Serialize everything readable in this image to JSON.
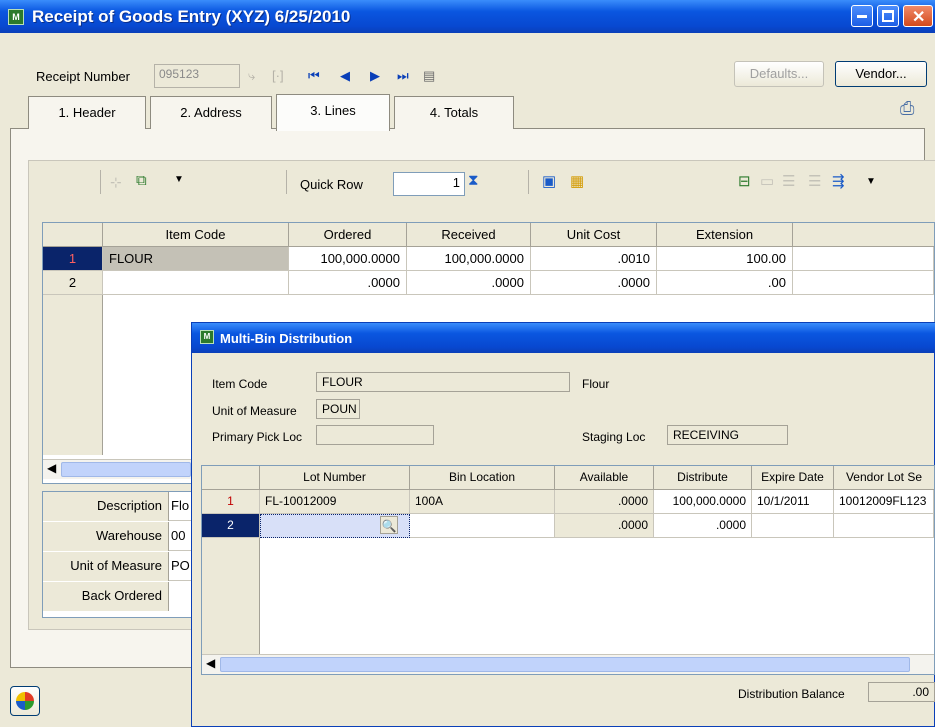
{
  "window": {
    "title": "Receipt of Goods Entry (XYZ) 6/25/2010",
    "app_icon": "mas-icon"
  },
  "header": {
    "receipt_number_label": "Receipt Number",
    "receipt_number_value": "095123",
    "defaults_label": "Defaults...",
    "vendor_label": "Vendor..."
  },
  "tabs": [
    {
      "label": "1. Header"
    },
    {
      "label": "2. Address"
    },
    {
      "label": "3. Lines",
      "active": true
    },
    {
      "label": "4. Totals"
    }
  ],
  "lines_toolbar": {
    "quick_row_label": "Quick Row",
    "quick_row_value": "1"
  },
  "grid": {
    "columns": [
      "Item Code",
      "Ordered",
      "Received",
      "Unit Cost",
      "Extension"
    ],
    "rows": [
      {
        "num": "1",
        "item": "FLOUR",
        "ordered": "100,000.0000",
        "received": "100,000.0000",
        "unit_cost": ".0010",
        "extension": "100.00"
      },
      {
        "num": "2",
        "item": "",
        "ordered": ".0000",
        "received": ".0000",
        "unit_cost": ".0000",
        "extension": ".00"
      }
    ]
  },
  "details": [
    {
      "label": "Description",
      "value": "Flo"
    },
    {
      "label": "Warehouse",
      "value": "00"
    },
    {
      "label": "Unit of Measure",
      "value": "PO"
    },
    {
      "label": "Back Ordered",
      "value": ""
    }
  ],
  "popup": {
    "title": "Multi-Bin Distribution",
    "item_code_label": "Item Code",
    "item_code_value": "FLOUR",
    "item_desc": "Flour",
    "uom_label": "Unit of Measure",
    "uom_value": "POUN",
    "primary_pick_label": "Primary Pick Loc",
    "primary_pick_value": "",
    "staging_label": "Staging Loc",
    "staging_value": "RECEIVING",
    "columns": [
      "Lot Number",
      "Bin Location",
      "Available",
      "Distribute",
      "Expire Date",
      "Vendor Lot Se"
    ],
    "rows": [
      {
        "num": "1",
        "lot": "FL-10012009",
        "bin": "100A",
        "available": ".0000",
        "distribute": "100,000.0000",
        "expire": "10/1/2011",
        "vendor_lot": "10012009FL123"
      },
      {
        "num": "2",
        "lot": "",
        "bin": "",
        "available": ".0000",
        "distribute": ".0000",
        "expire": "",
        "vendor_lot": ""
      }
    ],
    "balance_label": "Distribution Balance",
    "balance_value": ".00"
  },
  "colors": {
    "titlebar": "#0a56e0",
    "selected_row": "#0a246a",
    "row_num_red": "#c00000"
  }
}
